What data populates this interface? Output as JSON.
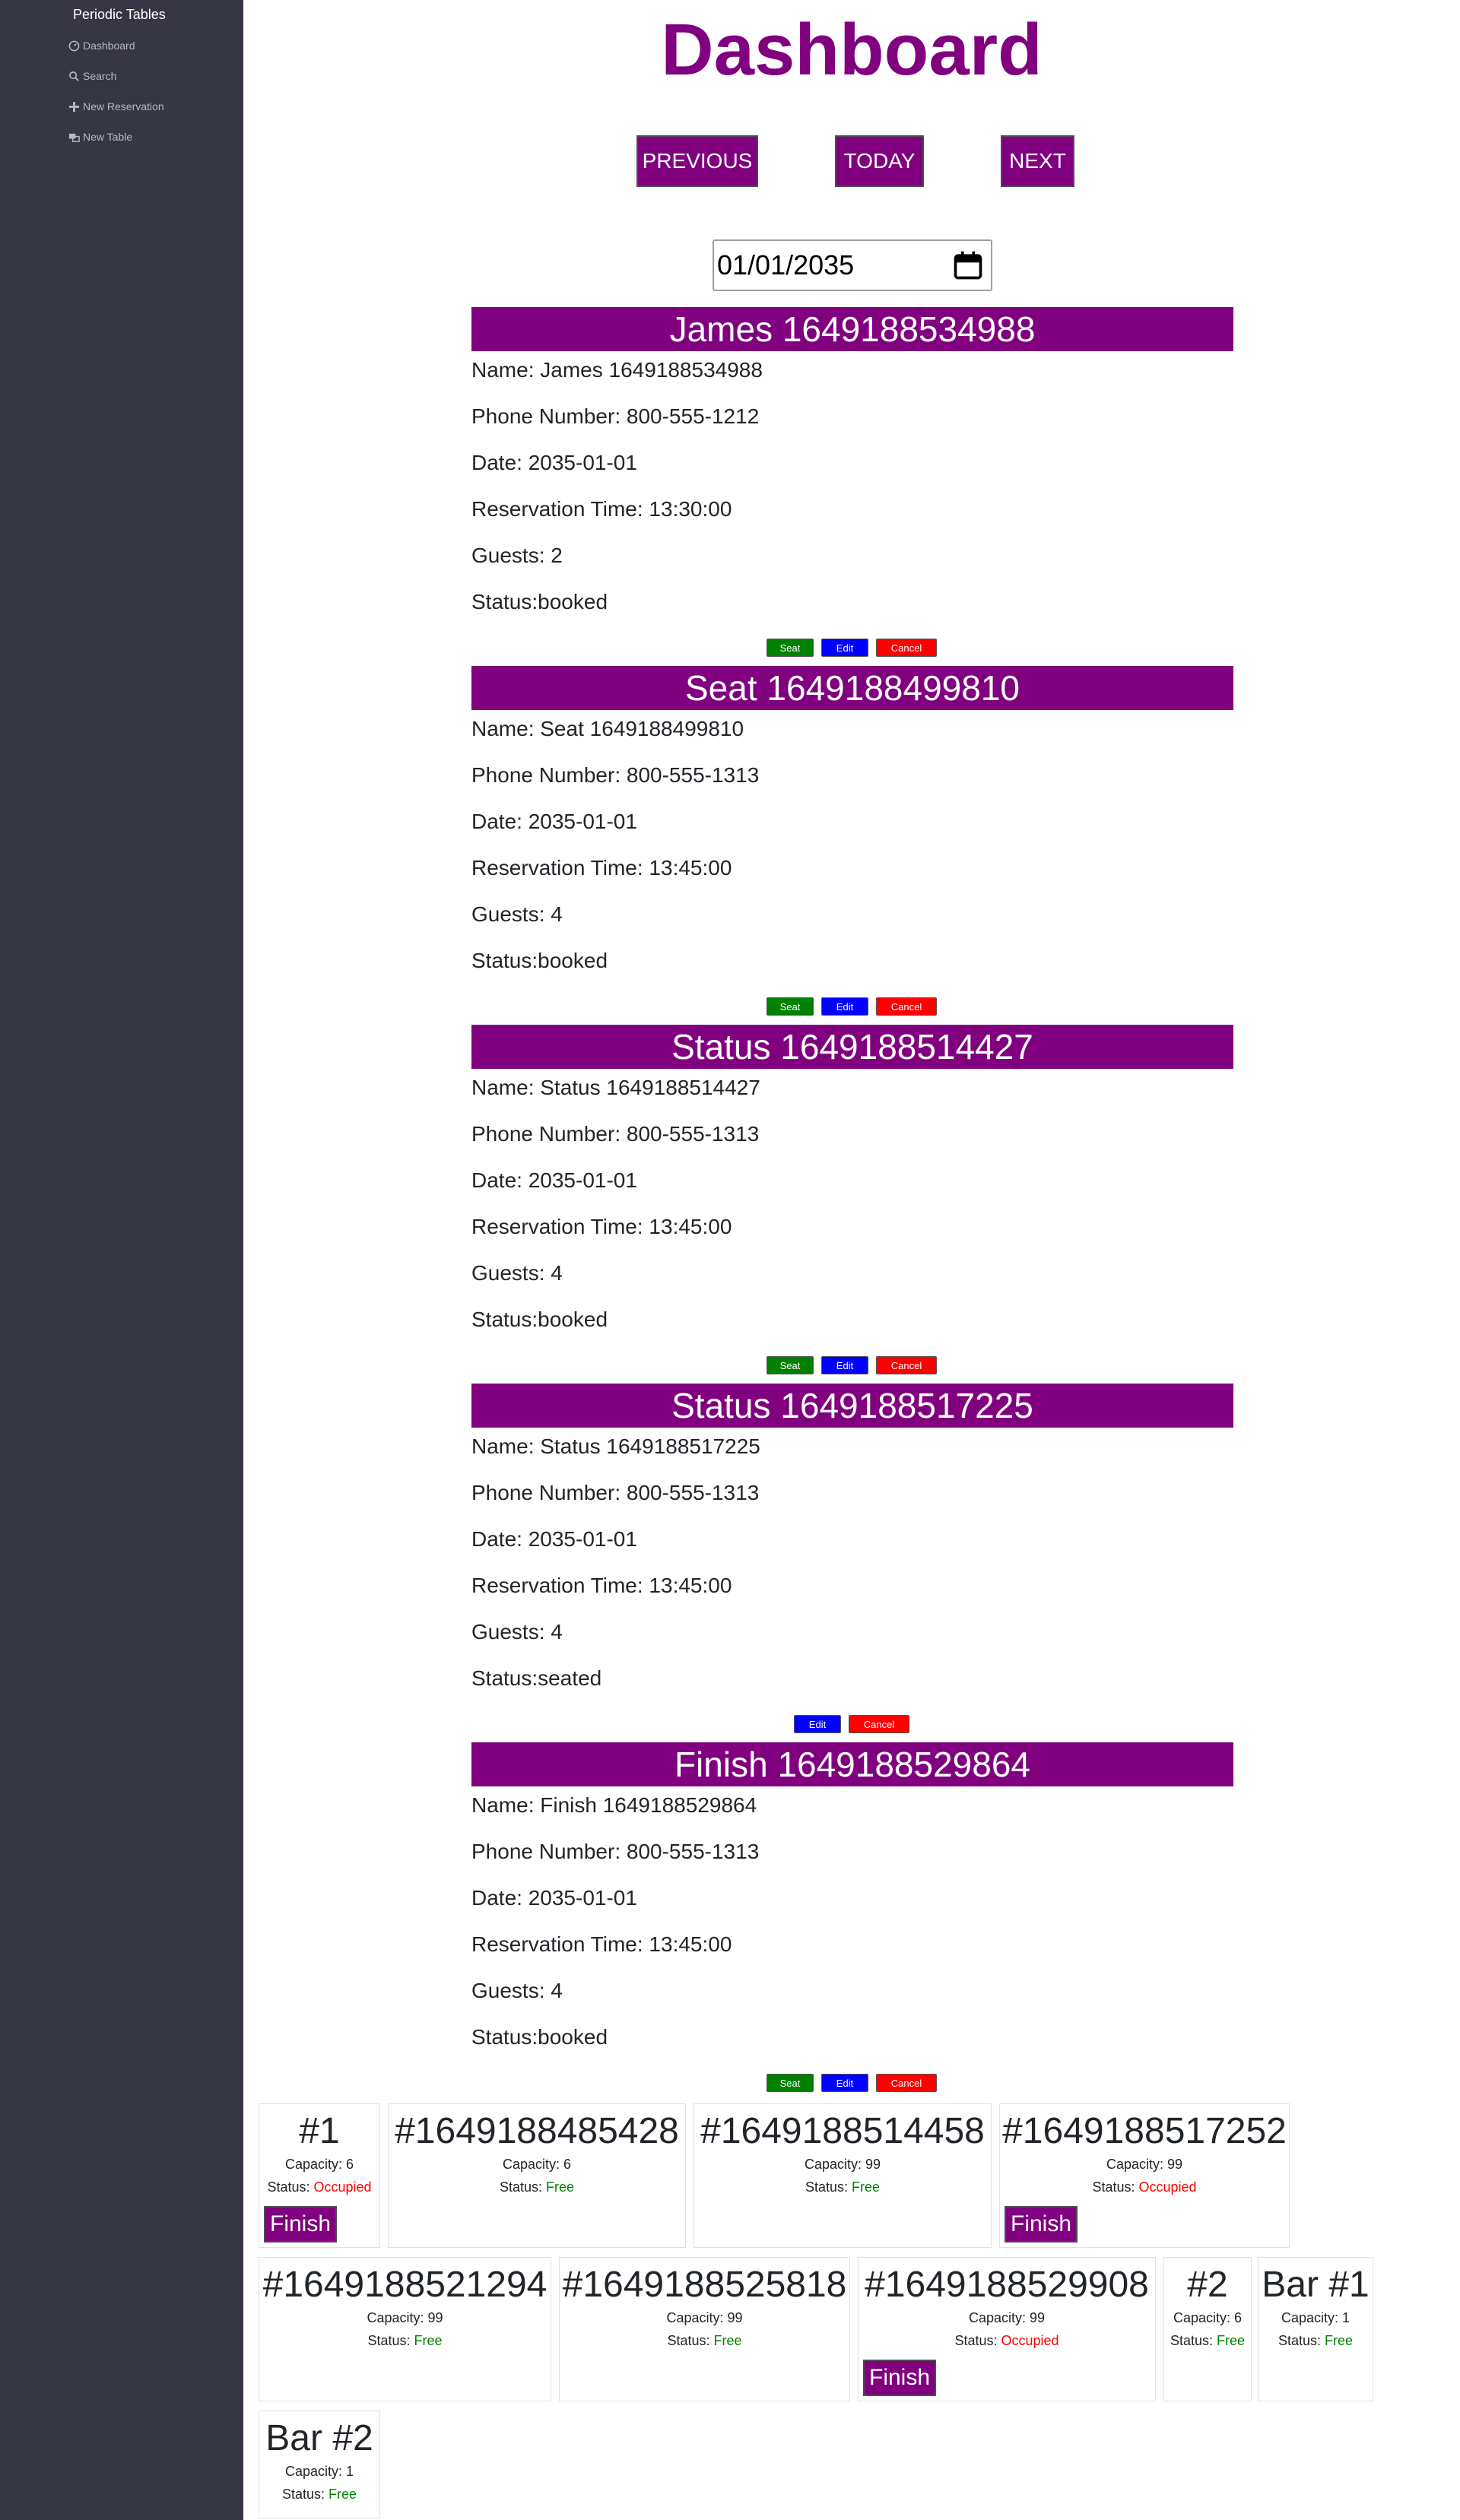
{
  "sidebar": {
    "brand": "Periodic Tables",
    "items": [
      {
        "label": "Dashboard",
        "icon": "dashboard-icon"
      },
      {
        "label": "Search",
        "icon": "search-icon"
      },
      {
        "label": "New Reservation",
        "icon": "plus-icon"
      },
      {
        "label": "New Table",
        "icon": "table-icon"
      }
    ]
  },
  "header": {
    "title": "Dashboard",
    "previous": "PREVIOUS",
    "today": "TODAY",
    "next": "NEXT",
    "date": "01/01/2035"
  },
  "reservations": [
    {
      "header": "James 1649188534988",
      "name": "Name: James 1649188534988",
      "phone": "Phone Number: 800-555-1212",
      "date": "Date: 2035-01-01",
      "time": "Reservation Time: 13:30:00",
      "guests": "Guests: 2",
      "status": "Status:booked"
    },
    {
      "header": "Seat 1649188499810",
      "name": "Name: Seat 1649188499810",
      "phone": "Phone Number: 800-555-1313",
      "date": "Date: 2035-01-01",
      "time": "Reservation Time: 13:45:00",
      "guests": "Guests: 4",
      "status": "Status:booked"
    },
    {
      "header": "Status 1649188514427",
      "name": "Name: Status 1649188514427",
      "phone": "Phone Number: 800-555-1313",
      "date": "Date: 2035-01-01",
      "time": "Reservation Time: 13:45:00",
      "guests": "Guests: 4",
      "status": "Status:booked"
    },
    {
      "header": "Status 1649188517225",
      "name": "Name: Status 1649188517225",
      "phone": "Phone Number: 800-555-1313",
      "date": "Date: 2035-01-01",
      "time": "Reservation Time: 13:45:00",
      "guests": "Guests: 4",
      "status": "Status:seated"
    },
    {
      "header": "Finish 1649188529864",
      "name": "Name: Finish 1649188529864",
      "phone": "Phone Number: 800-555-1313",
      "date": "Date: 2035-01-01",
      "time": "Reservation Time: 13:45:00",
      "guests": "Guests: 4",
      "status": "Status:booked"
    }
  ],
  "actions": {
    "seat": "Seat",
    "edit": "Edit",
    "cancel": "Cancel"
  },
  "tables": [
    {
      "name": "#1",
      "capacity": "Capacity: 6",
      "status_label": "Status: ",
      "status": "Occupied",
      "finish": "Finish"
    },
    {
      "name": "#1649188485428",
      "capacity": "Capacity: 6",
      "status_label": "Status: ",
      "status": "Free"
    },
    {
      "name": "#1649188514458",
      "capacity": "Capacity: 99",
      "status_label": "Status: ",
      "status": "Free"
    },
    {
      "name": "#1649188517252",
      "capacity": "Capacity: 99",
      "status_label": "Status: ",
      "status": "Occupied",
      "finish": "Finish"
    },
    {
      "name": "#1649188521294",
      "capacity": "Capacity: 99",
      "status_label": "Status: ",
      "status": "Free"
    },
    {
      "name": "#1649188525818",
      "capacity": "Capacity: 99",
      "status_label": "Status: ",
      "status": "Free"
    },
    {
      "name": "#1649188529908",
      "capacity": "Capacity: 99",
      "status_label": "Status: ",
      "status": "Occupied",
      "finish": "Finish"
    },
    {
      "name": "#2",
      "capacity": "Capacity: 6",
      "status_label": "Status: ",
      "status": "Free"
    },
    {
      "name": "Bar #1",
      "capacity": "Capacity: 1",
      "status_label": "Status: ",
      "status": "Free"
    },
    {
      "name": "Bar #2",
      "capacity": "Capacity: 1",
      "status_label": "Status: ",
      "status": "Free"
    }
  ],
  "colors": {
    "brand": "#800080",
    "sidebar": "#363742",
    "seat": "#008000",
    "edit": "#0000ff",
    "cancel": "#ff0000",
    "occupied": "#ff0000",
    "free": "#008000"
  }
}
